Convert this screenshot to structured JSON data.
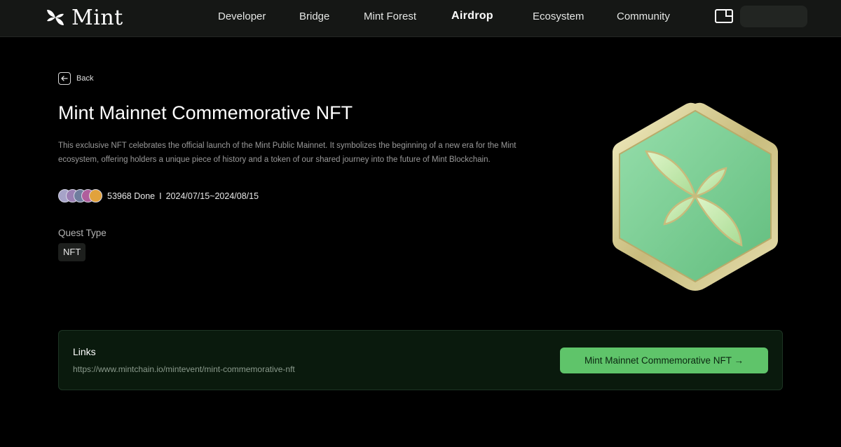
{
  "header": {
    "logo_text": "Mint",
    "nav": [
      {
        "label": "Developer"
      },
      {
        "label": "Bridge"
      },
      {
        "label": "Mint Forest"
      },
      {
        "label": "Airdrop"
      },
      {
        "label": "Ecosystem"
      },
      {
        "label": "Community"
      }
    ],
    "active_nav": "Airdrop"
  },
  "back_label": "Back",
  "quest": {
    "title": "Mint Mainnet Commemorative NFT",
    "description": "This exclusive NFT celebrates the official launch of the Mint Public Mainnet. It symbolizes the beginning of a new era for the Mint ecosystem, offering holders a unique piece of history and a token of our shared journey into the future of Mint Blockchain.",
    "done_count": "53968 Done",
    "separator": "I",
    "date_range": "2024/07/15~2024/08/15",
    "type_label": "Quest Type",
    "type_value": "NFT"
  },
  "links": {
    "title": "Links",
    "url": "https://www.mintchain.io/mintevent/mint-commemorative-nft",
    "button_label": "Mint Mainnet Commemorative NFT →"
  },
  "colors": {
    "background": "#000000",
    "navbar": "#151715",
    "accent": "#5fc46a",
    "card_bg": "#0a1a0d"
  },
  "icons": {
    "logo": "mint-leaf-icon",
    "back": "arrow-left-icon",
    "wallet": "wallet-icon",
    "nft": "hexagon-leaf-badge"
  }
}
